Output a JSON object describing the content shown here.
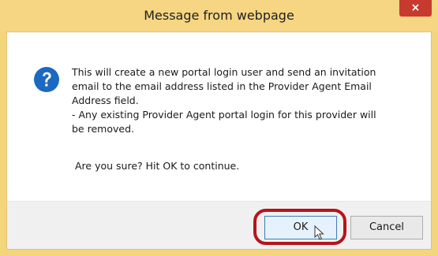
{
  "dialog": {
    "title": "Message from webpage",
    "close_glyph": "×",
    "icon": "question-icon",
    "message_lines": [
      "This will create a new portal login user and send an invitation",
      "email to the email address listed in the Provider Agent Email",
      "Address field.",
      "- Any existing Provider Agent portal login for this provider will",
      "be removed."
    ],
    "confirm_text": "Are you sure? Hit OK to continue.",
    "ok_label": "OK",
    "cancel_label": "Cancel"
  },
  "colors": {
    "titlebar": "#f6d583",
    "close_button": "#c73b2e",
    "question_icon": "#1c69c1",
    "highlight_ring": "#b5141d"
  }
}
